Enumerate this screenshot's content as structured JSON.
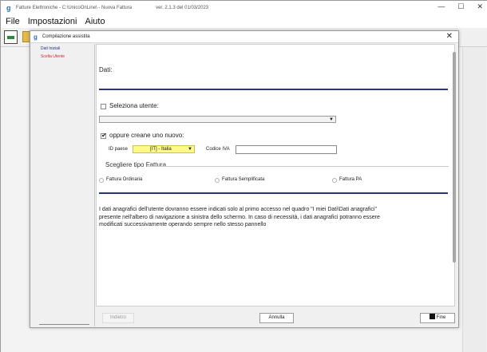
{
  "window": {
    "title": "Fatture Elettroniche - C:\\UnicoOnLine\\ - Nuova Fattura",
    "version": "ver. 2.1.3 del 01/03/2023",
    "icon": "app-logo-g"
  },
  "menu": {
    "items": [
      "File",
      "Impostazioni",
      "Aiuto"
    ]
  },
  "dialog": {
    "title": "Compilazione assistita",
    "sidebar": {
      "items": [
        "Dati Iniziali",
        "Scelta Utente"
      ]
    },
    "main": {
      "dati_label": "Dati:",
      "seleziona_label": "Seleziona utente:",
      "seleziona_checked": false,
      "crea_label": "oppure creane uno nuovo:",
      "crea_checked": true,
      "id_paese_label": "ID paese",
      "id_paese_value": "[IT] - Italia",
      "codice_iva_label": "Codice IVA",
      "codice_iva_value": "",
      "tipo_fattura_title": "Scegliere tipo Fattura",
      "tipo_options": [
        "Fattura Ordinaria",
        "Fattura Semplificata",
        "Fattura PA"
      ],
      "info_text": "I dati anagrafici dell'utente dovranno essere indicati solo al primo accesso nel quadro \"I miei Dati\\Dati anagrafici\" presente nell'albero di navigazione a sinistra dello schermo. In caso di necessità, i dati anagrafici potranno essere modificati successivamente operando sempre nello stesso pannello"
    },
    "buttons": {
      "back": "Indietro",
      "cancel": "Annulla",
      "finish": "Fine"
    }
  },
  "colors": {
    "accent_rule": "#2a3478",
    "highlight_field": "#fff88a",
    "sidebar_active": "#1a2f8a",
    "sidebar_next": "#d8232a"
  }
}
